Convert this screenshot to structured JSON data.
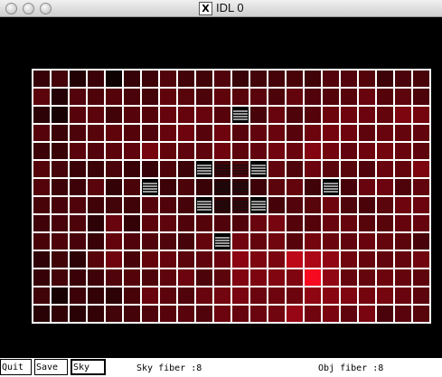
{
  "window": {
    "title": "IDL 0"
  },
  "controls": {
    "quit_label": "Quit",
    "save_label": "Save",
    "sky_label": "Sky"
  },
  "status": {
    "sky_fiber": "Sky fiber :8",
    "obj_fiber": "Obj fiber :8"
  },
  "colors": {
    "grid_line": "#ffffff",
    "background": "#000000",
    "hot_pixel": "#ff0022"
  },
  "grid": {
    "cols": 22,
    "rows": 14,
    "sky_fibers": [
      [
        11,
        2
      ],
      [
        9,
        5
      ],
      [
        12,
        5
      ],
      [
        6,
        6
      ],
      [
        16,
        6
      ],
      [
        9,
        7
      ],
      [
        12,
        7
      ],
      [
        10,
        9
      ]
    ],
    "object_fibers": [
      [
        10,
        5
      ],
      [
        11,
        5
      ],
      [
        10,
        6
      ],
      [
        11,
        6
      ],
      [
        10,
        7
      ],
      [
        11,
        7
      ]
    ],
    "cells": [
      [
        55,
        67,
        34,
        58,
        13,
        53,
        60,
        80,
        65,
        65,
        81,
        56,
        66,
        69,
        72,
        63,
        82,
        82,
        85,
        61,
        74,
        72
      ],
      [
        92,
        36,
        82,
        78,
        84,
        74,
        68,
        96,
        88,
        77,
        96,
        88,
        89,
        76,
        99,
        81,
        84,
        87,
        104,
        84,
        94,
        76
      ],
      [
        45,
        24,
        87,
        92,
        65,
        87,
        85,
        102,
        101,
        104,
        86,
        90,
        70,
        104,
        78,
        85,
        108,
        109,
        107,
        99,
        124,
        116
      ],
      [
        87,
        59,
        77,
        88,
        96,
        84,
        79,
        102,
        109,
        87,
        109,
        87,
        98,
        104,
        86,
        108,
        116,
        110,
        94,
        104,
        100,
        98
      ],
      [
        59,
        57,
        89,
        82,
        92,
        95,
        117,
        99,
        94,
        93,
        111,
        94,
        98,
        112,
        104,
        131,
        115,
        98,
        110,
        115,
        104,
        93
      ],
      [
        85,
        70,
        58,
        59,
        74,
        57,
        54,
        78,
        59,
        93,
        60,
        77,
        89,
        98,
        79,
        107,
        90,
        88,
        81,
        104,
        99,
        124
      ],
      [
        84,
        61,
        61,
        90,
        51,
        75,
        51,
        60,
        76,
        56,
        40,
        48,
        60,
        91,
        99,
        63,
        80,
        71,
        103,
        107,
        78,
        98
      ],
      [
        72,
        71,
        80,
        63,
        66,
        64,
        85,
        81,
        70,
        90,
        48,
        56,
        59,
        69,
        83,
        88,
        110,
        79,
        73,
        90,
        109,
        107
      ],
      [
        62,
        71,
        77,
        45,
        104,
        51,
        91,
        93,
        81,
        85,
        81,
        81,
        104,
        118,
        84,
        84,
        104,
        102,
        88,
        88,
        101,
        102
      ],
      [
        72,
        76,
        71,
        57,
        99,
        80,
        81,
        79,
        70,
        99,
        89,
        112,
        100,
        112,
        87,
        116,
        106,
        97,
        105,
        100,
        92,
        71
      ],
      [
        46,
        63,
        45,
        88,
        111,
        71,
        99,
        101,
        90,
        95,
        105,
        139,
        124,
        122,
        189,
        171,
        144,
        111,
        102,
        98,
        100,
        113
      ],
      [
        55,
        68,
        58,
        62,
        81,
        84,
        78,
        93,
        107,
        76,
        92,
        128,
        124,
        129,
        127,
        245,
        145,
        102,
        100,
        108,
        101,
        93
      ],
      [
        64,
        23,
        60,
        50,
        44,
        72,
        104,
        91,
        80,
        104,
        114,
        121,
        106,
        110,
        108,
        142,
        136,
        127,
        116,
        117,
        105,
        91
      ],
      [
        40,
        48,
        41,
        50,
        66,
        67,
        79,
        87,
        89,
        80,
        107,
        102,
        106,
        112,
        150,
        113,
        122,
        95,
        121,
        74,
        89,
        88
      ]
    ]
  }
}
